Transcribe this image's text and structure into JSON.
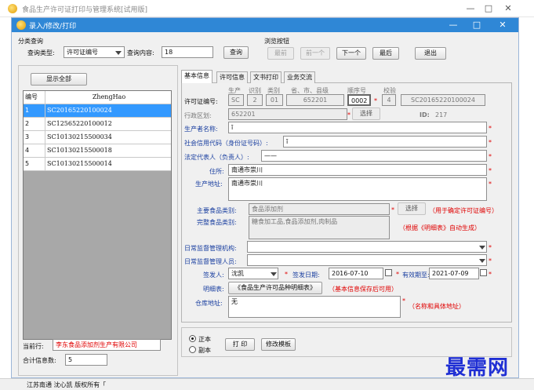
{
  "window_title": "食品生产许可证打印与管理系统[试用版]",
  "dialog_title": "录入/修改/打印",
  "query": {
    "group": "分类查询",
    "type_label": "查询类型:",
    "type_value": "许可证编号",
    "content_label": "查询内容:",
    "content_value": "18",
    "button": "查询"
  },
  "browse": {
    "group": "浏览按钮",
    "first": "最前",
    "prev": "前一个",
    "next": "下一个",
    "last": "最后",
    "exit": "退出"
  },
  "list": {
    "show_all": "显示全部",
    "headers": [
      "编号",
      "ZhengHao"
    ],
    "rows": [
      [
        "1",
        "SC20165220100024"
      ],
      [
        "2",
        "SC12565220100012"
      ],
      [
        "3",
        "SC10130215500034"
      ],
      [
        "4",
        "SC10130215500018"
      ],
      [
        "5",
        "SC10130215500014"
      ]
    ],
    "selected_index": 0
  },
  "current_label": "当前行:",
  "current_value": "李东食品添加剂生产有限公司",
  "total_label": "合计信息数:",
  "total_value": "5",
  "tabs": [
    "基本信息",
    "许可信息",
    "文书打印",
    "业务交流"
  ],
  "form": {
    "col_heads": [
      "生产",
      "识别",
      "类别",
      "省、市、县级",
      "顺序号",
      "校验"
    ],
    "license_label": "许可证编号:",
    "license_parts": [
      "SC",
      "2",
      "01",
      "652201",
      "0002",
      "4",
      "SC20165220100024"
    ],
    "region_label": "行政区划:",
    "region_value": "652201",
    "select_label": "选择",
    "id_label": "ID:",
    "id_value": "217",
    "producer_label": "生产者名称:",
    "producer_value": "ī",
    "credit_label": "社会信用代码（身份证号码）:",
    "credit_value": "ī",
    "legal_label": "法定代表人（负责人）:",
    "legal_value": "——",
    "address_label": "住所:",
    "address_value": "南通市崇川",
    "prod_addr_label": "生产地址:",
    "prod_addr_value": "南通市崇川",
    "main_cat_label": "主要食品类别:",
    "main_cat_value": "食品添加剂",
    "main_cat_note": "（用于确定许可证编号）",
    "full_cat_label": "完整食品类别:",
    "full_cat_value": "糖食加工品,食品添加剂,肉制品",
    "full_cat_note": "（根据《明细表》自动生成）",
    "agency_label": "日常监督管理机构:",
    "agency_value": "",
    "staff_label": "日常监督管理人员:",
    "staff_value": "",
    "signer_label": "签发人:",
    "signer_value": "沈凯",
    "issue_label": "签发日期:",
    "issue_value": "2016-07-10",
    "valid_label": "有效期至:",
    "valid_value": "2021-07-09",
    "detail_label": "明细表:",
    "detail_button": "《食品生产许可品种明细表》",
    "detail_note": "（基本信息保存后可用）",
    "warehouse_label": "仓库地址:",
    "warehouse_value": "无",
    "warehouse_note": "（名称和具体地址）",
    "star": "*"
  },
  "bottom": {
    "radio_original": "正本",
    "radio_copy": "副本",
    "print": "打 印",
    "edit_template": "修改模板"
  },
  "status_bar": "江苏南通 沈心凯 版权所有「",
  "watermark": "最需网"
}
